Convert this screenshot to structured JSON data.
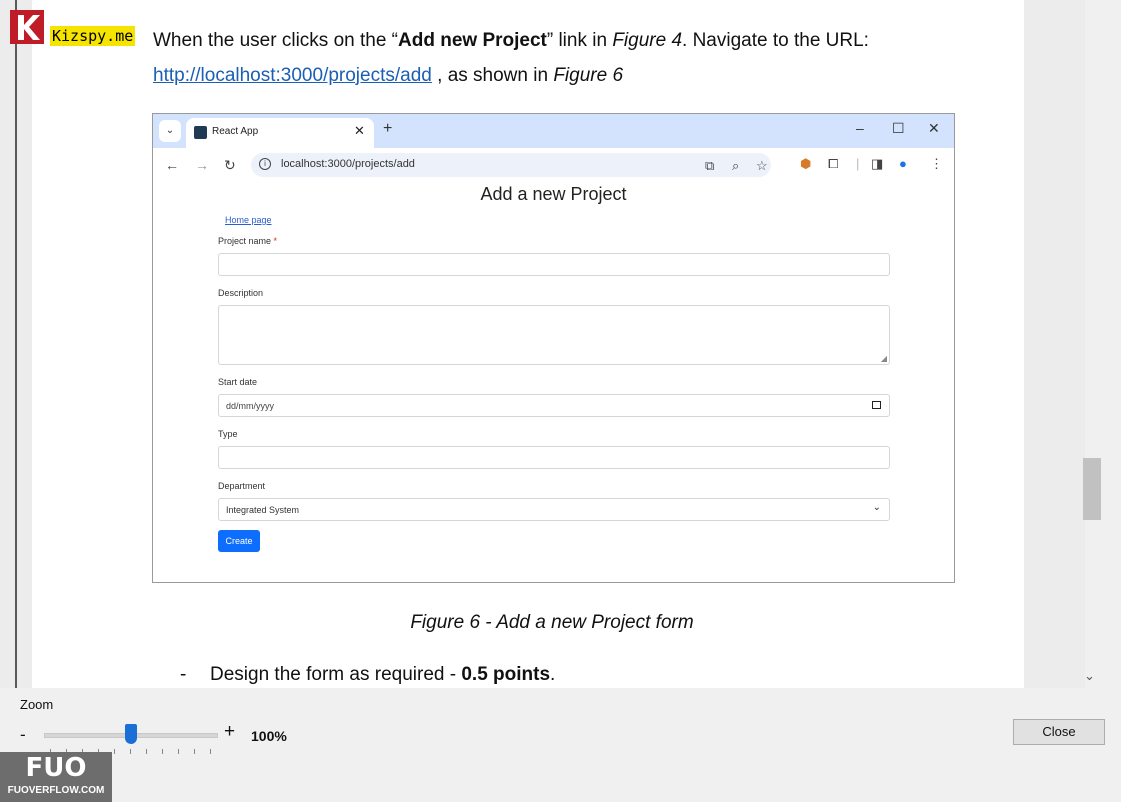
{
  "document": {
    "logo_text": "Kizspy.me",
    "line1_a": "When the user clicks on the “",
    "line1_bold": "Add new Project",
    "line1_b": "” link in ",
    "line1_italic": "Figure 4",
    "line1_c": ". Navigate to the URL:",
    "line2_link": "http://localhost:3000/projects/add",
    "line2_a": " , as shown in ",
    "line2_italic": "Figure 6",
    "caption": "Figure 6 - Add a new Project form",
    "bullet_dash": "-",
    "bullet_a": "Design the form as required - ",
    "bullet_bold": "0.5 points",
    "bullet_b": "."
  },
  "browser": {
    "tab_title": "React App",
    "url": "localhost:3000/projects/add"
  },
  "app": {
    "title": "Add a new Project",
    "home_link": "Home page",
    "project_name_label": "Project name",
    "required_mark": "*",
    "description_label": "Description",
    "start_date_label": "Start date",
    "start_date_placeholder": "dd/mm/yyyy",
    "type_label": "Type",
    "department_label": "Department",
    "department_value": "Integrated System",
    "create_button": "Create"
  },
  "controls": {
    "zoom_label": "Zoom",
    "zoom_minus": "-",
    "zoom_plus": "+",
    "zoom_value": "100%",
    "close_button": "Close"
  },
  "badge": {
    "mark": "FUO",
    "text": "FUOVERFLOW.COM"
  }
}
